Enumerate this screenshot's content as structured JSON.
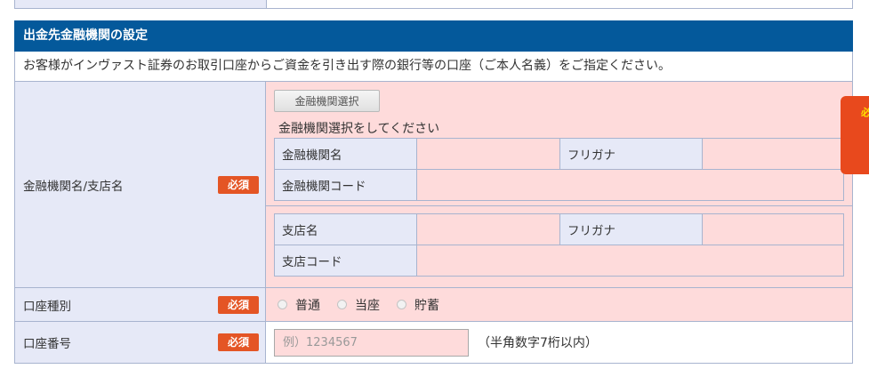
{
  "section": {
    "title": "出金先金融機関の設定",
    "description": "お客様がインヴァスト証券のお取引口座からご資金を引き出す際の銀行等の口座（ご本人名義）をご指定ください。"
  },
  "required_label": "必須",
  "bank": {
    "label": "金融機関名/支店名",
    "select_button": "金融機関選択",
    "hint": "金融機関選択をしてください",
    "bank_name_label": "金融機関名",
    "bank_name_value": "",
    "furigana_label": "フリガナ",
    "bank_furigana_value": "",
    "bank_code_label": "金融機関コード",
    "bank_code_value": "",
    "branch_name_label": "支店名",
    "branch_name_value": "",
    "branch_furigana_value": "",
    "branch_code_label": "支店コード",
    "branch_code_value": ""
  },
  "account_type": {
    "label": "口座種別",
    "options": [
      "普通",
      "当座",
      "貯蓄"
    ],
    "selected": null
  },
  "account_number": {
    "label": "口座番号",
    "value": "",
    "placeholder": "例）1234567",
    "note": "（半角数字7桁以内）"
  },
  "side_tab": {
    "text": "必"
  },
  "colors": {
    "header_bg": "#04599b",
    "label_bg": "#e6e9f7",
    "value_bg": "#fedbdb",
    "required_badge": "#e45525",
    "border": "#a8b4cf"
  }
}
